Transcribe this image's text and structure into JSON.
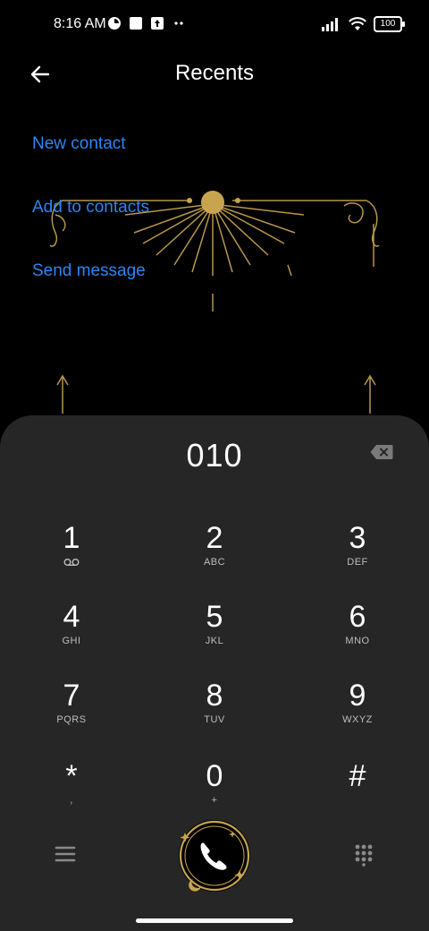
{
  "status_bar": {
    "time": "8:16 AM",
    "battery": "100",
    "icons": [
      "data-saver-icon",
      "square-notification-icon",
      "upload-icon",
      "more-dots-icon",
      "signal-icon",
      "wifi-icon",
      "battery-icon"
    ]
  },
  "header": {
    "title": "Recents",
    "back_icon": "arrow-left-icon"
  },
  "actions": {
    "new_contact": "New contact",
    "add_to_contacts": "Add to contacts",
    "send_message": "Send message"
  },
  "dialer": {
    "number": "010",
    "keys": [
      {
        "digit": "1",
        "letters": ""
      },
      {
        "digit": "2",
        "letters": "ABC"
      },
      {
        "digit": "3",
        "letters": "DEF"
      },
      {
        "digit": "4",
        "letters": "GHI"
      },
      {
        "digit": "5",
        "letters": "JKL"
      },
      {
        "digit": "6",
        "letters": "MNO"
      },
      {
        "digit": "7",
        "letters": "PQRS"
      },
      {
        "digit": "8",
        "letters": "TUV"
      },
      {
        "digit": "9",
        "letters": "WXYZ"
      },
      {
        "digit": "*",
        "letters": ","
      },
      {
        "digit": "0",
        "letters": "+"
      },
      {
        "digit": "#",
        "letters": ""
      }
    ]
  },
  "colors": {
    "accent": "#2b86f2",
    "panel": "#262626",
    "gold": "#c8a44f"
  }
}
